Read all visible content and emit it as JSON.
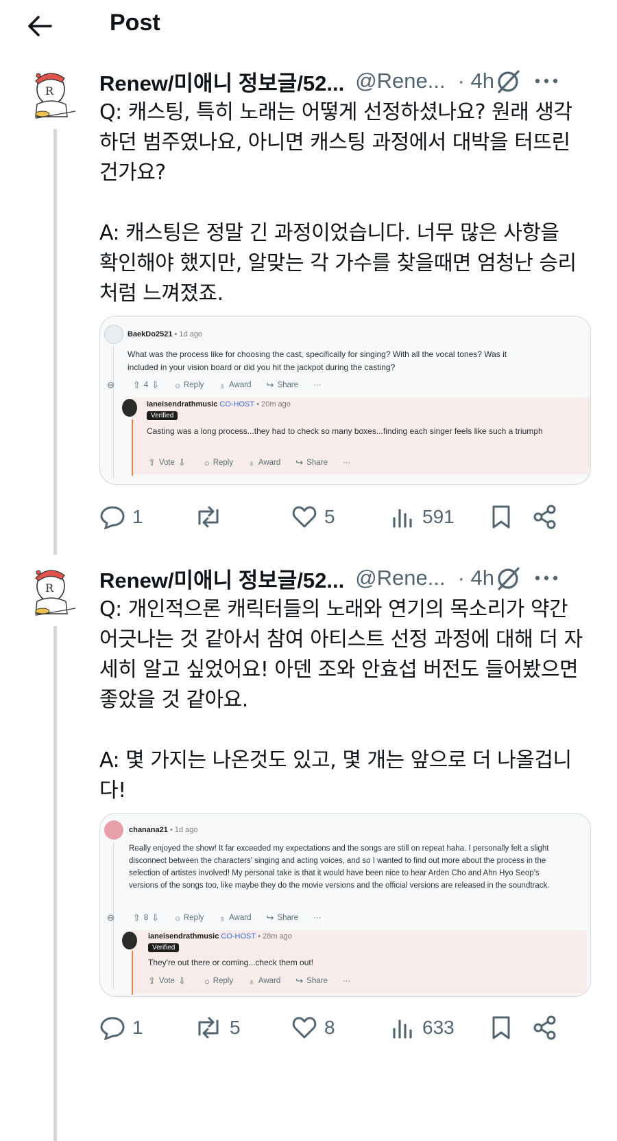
{
  "header": {
    "title": "Post"
  },
  "posts": [
    {
      "author": "Renew/미애니 정보글/52...",
      "handle": "@Rene...",
      "time": "· 4h",
      "text": "Q: 캐스팅, 특히 노래는 어떻게 선정하셨나요? 원래 생각\n하던 범주였나요, 아니면 캐스팅 과정에서 대박을 터뜨린\n건가요?\n\nA: 캐스팅은 정말 긴 과정이었습니다. 너무 많은 사항을\n확인해야 했지만, 알맞는 각 가수를 찾을때면 엄청난 승리\n처럼 느껴졌죠.",
      "embed": {
        "user": "BaekDo2521",
        "ago": "• 1d ago",
        "comment": "What was the process like for choosing the cast, specifically for singing? With all the vocal tones? Was it included in your vision board or did you hit the jackpot during the casting?",
        "votes": "4",
        "reply_label": "Reply",
        "award_label": "Award",
        "share_label": "Share",
        "more_label": "···",
        "reply_user": "ianeisendrathmusic",
        "reply_role": "CO-HOST",
        "reply_ago": "• 20m ago",
        "verified": "Verified",
        "reply_text": "Casting was a long process...they had to check so many boxes...finding each singer feels like such a triumph",
        "vote_label": "Vote"
      },
      "stats": {
        "replies": "1",
        "reposts": "",
        "likes": "5",
        "views": "591"
      }
    },
    {
      "author": "Renew/미애니 정보글/52...",
      "handle": "@Rene...",
      "time": "· 4h",
      "text": "Q: 개인적으론 캐릭터들의 노래와 연기의 목소리가 약간\n어긋나는 것 같아서 참여 아티스트 선정 과정에 대해 더 자\n세히 알고 싶었어요! 아덴 조와 안효섭 버전도 들어봤으면\n좋았을 것 같아요.\n\nA: 몇 가지는 나온것도 있고, 몇 개는 앞으로 더 나올겁니\n다!",
      "embed": {
        "user": "chanana21",
        "ago": "• 1d ago",
        "comment": "Really enjoyed the show! It far exceeded my expectations and the songs are still on repeat haha. I personally felt a slight disconnect between the characters' singing and acting voices, and so I wanted to find out more about the process in the selection of artistes involved! My personal take is that it would have been nice to hear Arden Cho and Ahn Hyo Seop's versions of the songs too, like maybe they do the movie versions and the official versions are released in the soundtrack.",
        "votes": "8",
        "reply_label": "Reply",
        "award_label": "Award",
        "share_label": "Share",
        "more_label": "···",
        "reply_user": "ianeisendrathmusic",
        "reply_role": "CO-HOST",
        "reply_ago": "• 28m ago",
        "verified": "Verified",
        "reply_text": "They're out there or coming...check them out!",
        "vote_label": "Vote"
      },
      "stats": {
        "replies": "1",
        "reposts": "5",
        "likes": "8",
        "views": "633"
      }
    }
  ],
  "colors": {
    "muted": "#536471",
    "thread": "#cfd9de",
    "reddit_accent": "#e8804a",
    "cohost": "#3b6fd4"
  },
  "icons": [
    "back-arrow-icon",
    "grok-icon",
    "more-icon",
    "reply-icon",
    "repost-icon",
    "like-icon",
    "views-icon",
    "bookmark-icon",
    "share-icon"
  ]
}
